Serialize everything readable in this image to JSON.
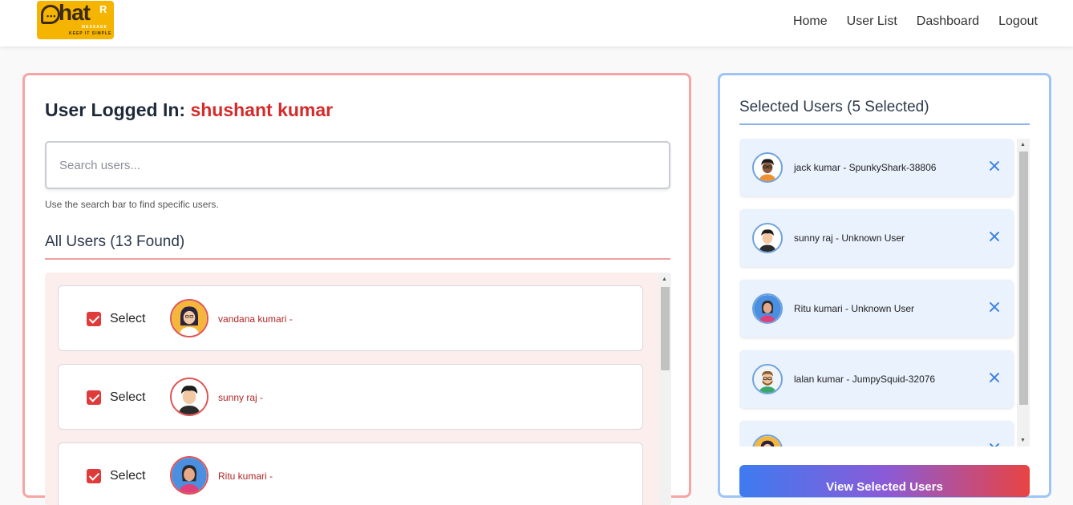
{
  "navbar": {
    "logo": {
      "text": "hat",
      "r": "R",
      "sub1": "MESSAGE",
      "sub2": "KEEP IT SIMPLE",
      "dots": "•••"
    },
    "links": [
      "Home",
      "User List",
      "Dashboard",
      "Logout"
    ]
  },
  "left": {
    "title_prefix": "User Logged In:",
    "title_name": "shushant kumar",
    "search_placeholder": "Search users...",
    "search_hint": "Use the search bar to find specific users.",
    "all_users_heading": "All Users (13 Found)",
    "select_label": "Select",
    "users": [
      {
        "name": "vandana kumari -",
        "avatar": "avatar-woman-yellow-icon"
      },
      {
        "name": "sunny raj -",
        "avatar": "avatar-man-dark-hair-icon"
      },
      {
        "name": "Ritu kumari -",
        "avatar": "avatar-woman-blue-icon"
      }
    ]
  },
  "right": {
    "heading": "Selected Users (5 Selected)",
    "selected": [
      {
        "name": "jack kumar - SpunkyShark-38806",
        "avatar": "avatar-man-glasses-icon"
      },
      {
        "name": "sunny raj - Unknown User",
        "avatar": "avatar-man-dark-hair-icon"
      },
      {
        "name": "Ritu kumari - Unknown User",
        "avatar": "avatar-woman-blue-icon"
      },
      {
        "name": "lalan kumar - JumpySquid-32076",
        "avatar": "avatar-man-beard-icon"
      },
      {
        "name": "",
        "avatar": "avatar-woman-yellow-icon"
      }
    ],
    "view_button_label": "View Selected Users"
  },
  "colors": {
    "accent_red": "#e03b3b",
    "accent_blue": "#3b82e0",
    "left_border": "#f7a4a4",
    "right_border": "#9ec5f5"
  }
}
